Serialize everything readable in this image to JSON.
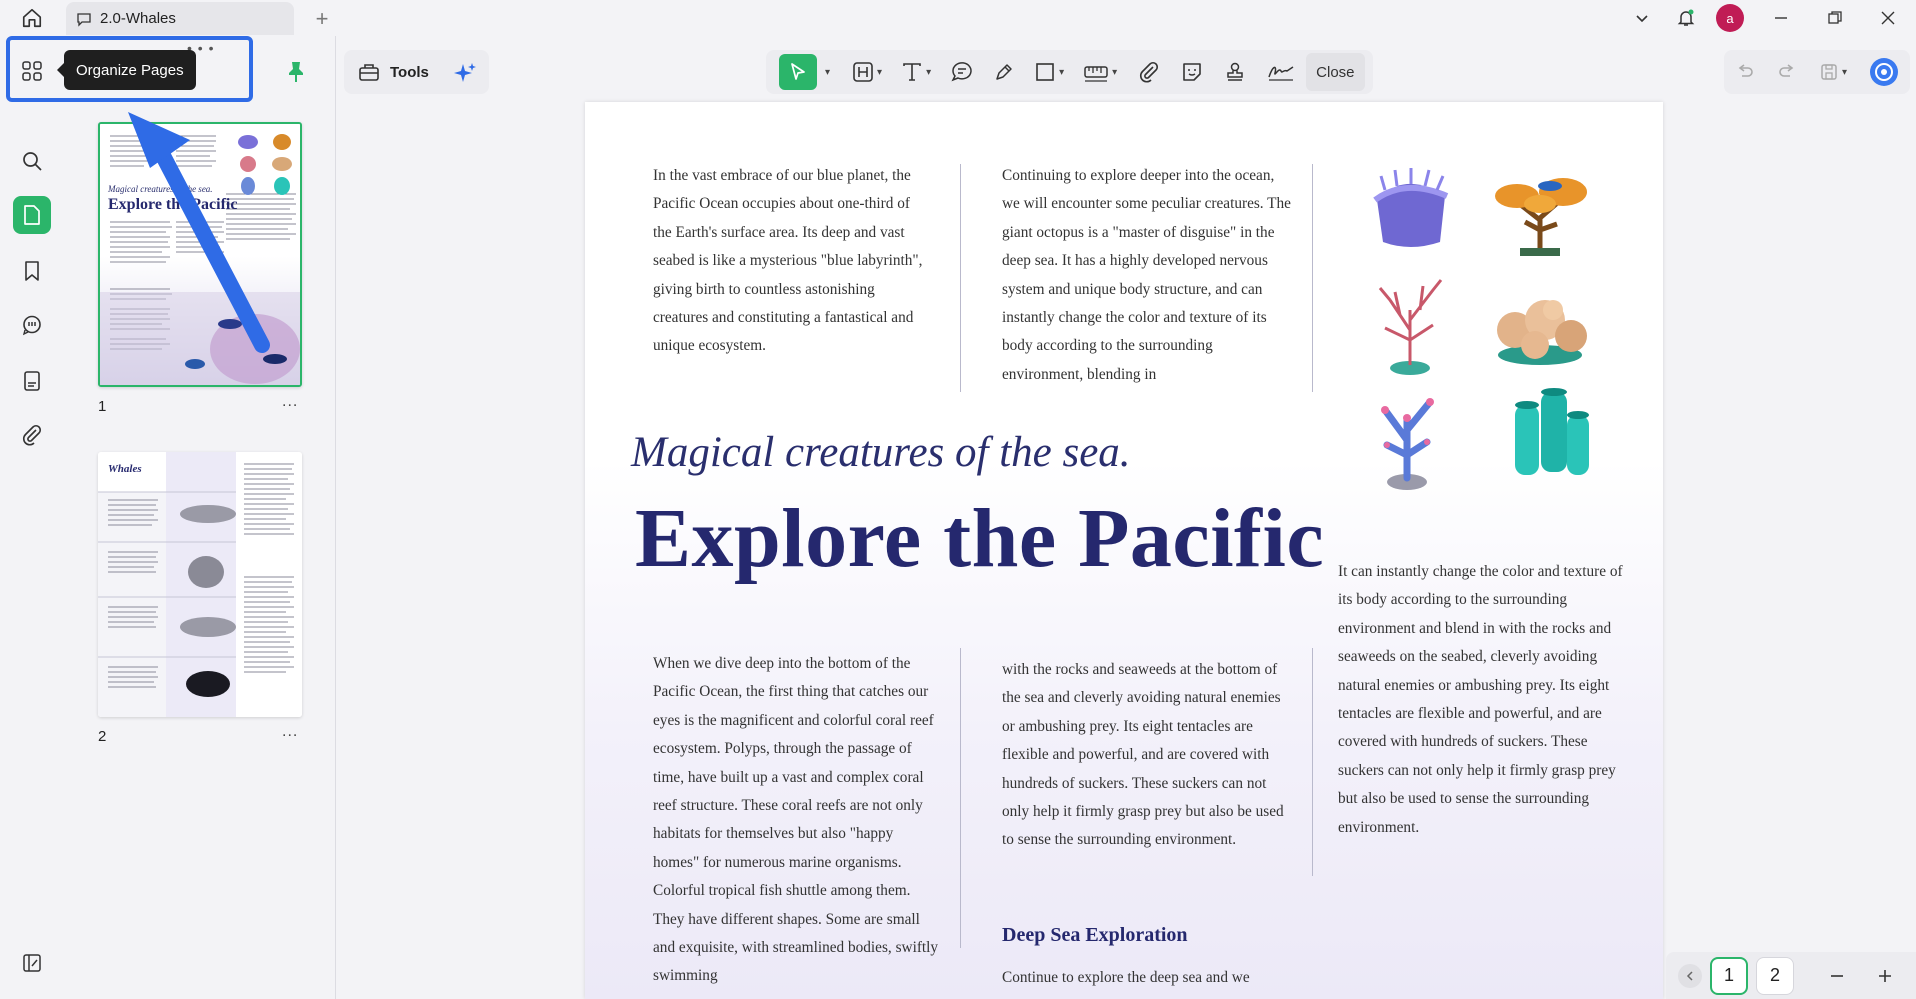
{
  "titlebar": {
    "tab_title": "2.0-Whales",
    "avatar_initial": "a"
  },
  "tooltip": {
    "text": "Organize Pages"
  },
  "thumbnails": [
    {
      "number": "1",
      "more": "..."
    },
    {
      "number": "2",
      "more": "..."
    }
  ],
  "toolbar": {
    "tools_label": "Tools",
    "close_label": "Close"
  },
  "pagenav": {
    "pages": [
      "1",
      "2"
    ],
    "current": "1"
  },
  "page": {
    "col1_top": "In the vast embrace of our blue planet, the Pacific Ocean occupies about one-third of the Earth's surface area. Its deep and vast seabed is like a mysterious \"blue labyrinth\", giving birth to countless astonishing creatures and constituting a fantastical and unique ecosystem.",
    "col2_top": "Continuing to explore deeper into the ocean, we will encounter some peculiar creatures. The giant octopus is a \"master of disguise\" in the deep sea. It has a highly developed nervous system and unique body structure, and can instantly change the color and texture of its body according to the surrounding environment, blending in",
    "subtitle": "Magical creatures of the sea.",
    "title": "Explore the Pacific",
    "col3_mid": "It can instantly change the color and texture of its body according to the surrounding environment and blend in with the rocks and seaweeds on the seabed, cleverly avoiding natural enemies or ambushing prey. Its eight tentacles are flexible and powerful, and are covered with hundreds of suckers. These suckers can not only help it firmly grasp prey but also be used to sense the surrounding environment.",
    "col1_bottom": "When we dive deep into the bottom of the Pacific Ocean, the first thing that catches our eyes is the magnificent and colorful coral reef ecosystem. Polyps, through the passage of time, have built up a vast and complex coral reef structure. These coral reefs are not only habitats for themselves but also \"happy homes\" for numerous marine organisms. Colorful tropical fish shuttle among them. They have different shapes. Some are small and exquisite, with streamlined bodies, swiftly swimming",
    "col2_bottom": "with the rocks and seaweeds at the bottom of the sea and cleverly avoiding natural enemies or ambushing prey. Its eight tentacles are flexible and powerful, and are covered with hundreds of suckers. These suckers can not only help it firmly grasp prey but also be used to sense the surrounding environment.",
    "deep_heading": "Deep Sea Exploration",
    "deep_text": "Continue to explore the deep sea and we"
  },
  "thumb_text": {
    "t1_subtitle": "Magical creatures of the sea.",
    "t1_title": "Explore the Pacific",
    "t2_title": "Whales"
  },
  "colors": {
    "accent_green": "#2bb56a",
    "highlight_blue": "#2f6be6",
    "title_navy": "#25286e"
  }
}
